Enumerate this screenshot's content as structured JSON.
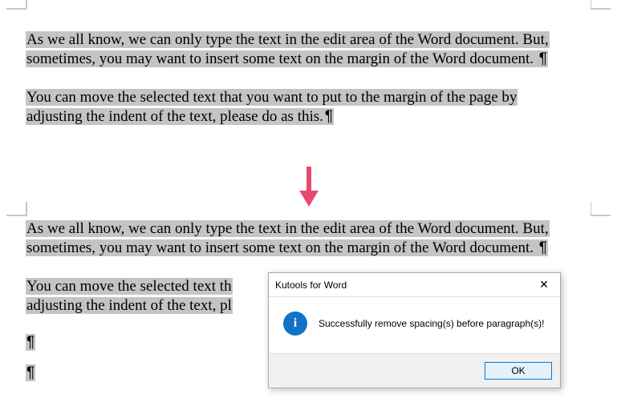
{
  "doc1": {
    "p1a": "As we all know, we can only type the text in the edit area of the Word document. But,",
    "p1b": "sometimes, you may want to insert some text on the margin of the Word document. ",
    "p1b_mark": "¶",
    "p2a": "You can move the selected text that you want to put to the margin of the page by",
    "p2b": "adjusting the indent of the text, please do as this.",
    "p2b_mark": "¶"
  },
  "doc2": {
    "p1a": "As we all know, we can only type the text in the edit area of the Word document. But,",
    "p1b": "sometimes, you may want to insert some text on the margin of the Word document. ",
    "p1b_mark": "¶",
    "p2a": "You can move the selected text th",
    "p2b": "adjusting the indent of the text, pl",
    "p3": "¶",
    "p4": "¶"
  },
  "dialog": {
    "title": "Kutools for Word",
    "message": "Successfully remove spacing(s) before paragraph(s)!",
    "ok_label": "OK",
    "close_glyph": "✕",
    "info_glyph": "i"
  },
  "colors": {
    "arrow": "#e84a6f",
    "highlight": "#c4c4c4",
    "dialog_accent": "#0078d7",
    "info_bg": "#1073c6"
  }
}
